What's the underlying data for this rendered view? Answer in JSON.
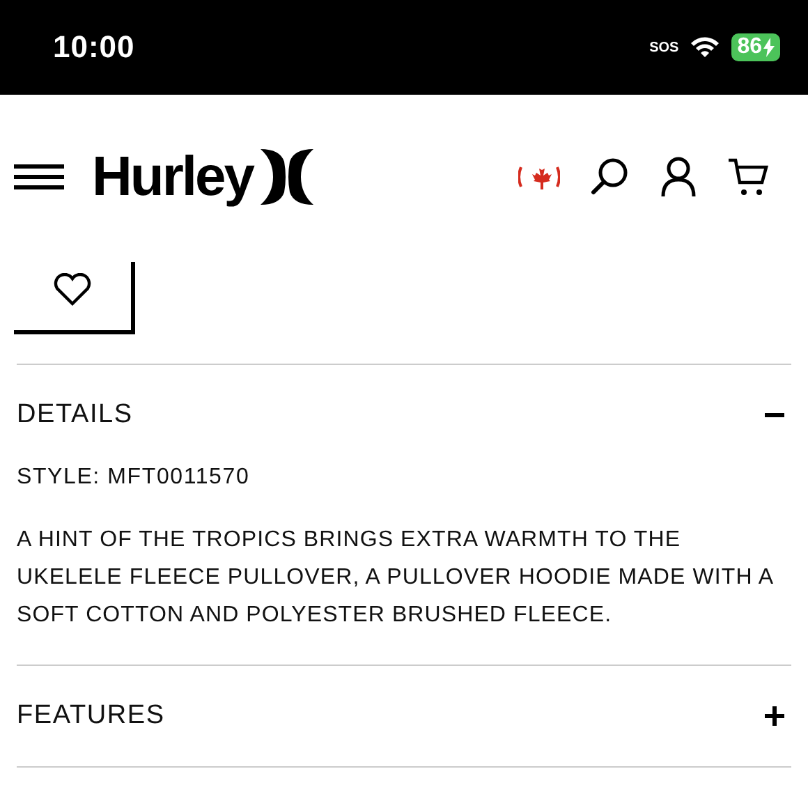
{
  "status_bar": {
    "time": "10:00",
    "carrier": "SOS",
    "battery": "86",
    "charging": true
  },
  "header": {
    "logo": "Hurley"
  },
  "sections": [
    {
      "title": "DETAILS",
      "expanded": true,
      "style": "STYLE: MFT0011570",
      "description": "A HINT OF THE TROPICS BRINGS EXTRA WARMTH TO THE UKELELE FLEECE PULLOVER, A PULLOVER HOODIE MADE WITH A SOFT COTTON AND POLYESTER BRUSHED FLEECE."
    },
    {
      "title": "FEATURES",
      "expanded": false
    }
  ]
}
